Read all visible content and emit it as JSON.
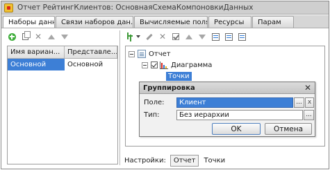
{
  "window": {
    "title": "Отчет РейтингКлиентов: ОсновнаяСхемаКомпоновкиДанных"
  },
  "tabs": [
    {
      "label": "Наборы данных"
    },
    {
      "label": "Связи наборов дан..."
    },
    {
      "label": "Вычисляемые поля"
    },
    {
      "label": "Ресурсы"
    },
    {
      "label": "Парам"
    }
  ],
  "variants_table": {
    "columns": [
      "Имя вариан...",
      "Представле..."
    ],
    "rows": [
      {
        "name": "Основной",
        "presentation": "Основной"
      }
    ]
  },
  "structure_tree": {
    "root": "Отчет",
    "chart": "Диаграмма",
    "points": "Точки"
  },
  "grouping_dialog": {
    "title": "Группировка",
    "field_label": "Поле:",
    "field_value": "Клиент",
    "type_label": "Тип:",
    "type_value": "Без иерархии",
    "ellipsis": "...",
    "clear": "x",
    "ok_label": "OK",
    "cancel_label": "Отмена"
  },
  "settings_bar": {
    "label": "Настройки:",
    "tabs": [
      "Отчет",
      "Точки"
    ]
  },
  "colors": {
    "selection": "#3d7fd6",
    "chart_bar_red": "#d9261c",
    "chart_bar_blue": "#2f6fc4",
    "chart_bar_yellow": "#e7b51c"
  }
}
